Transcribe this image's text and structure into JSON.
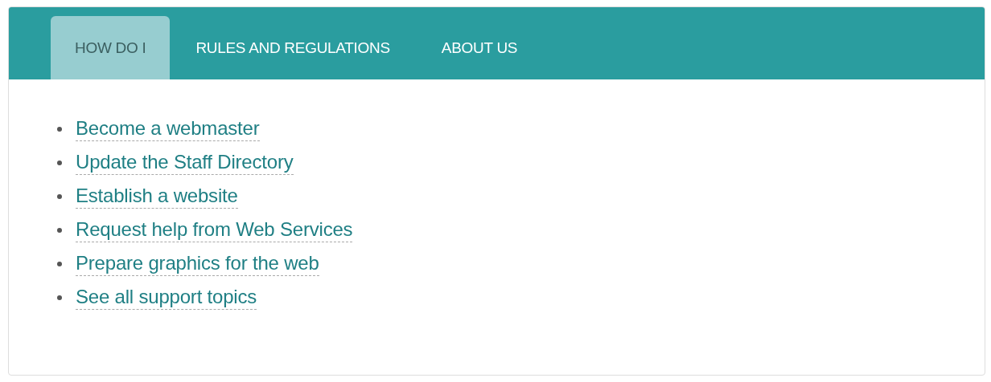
{
  "tabs": [
    {
      "label": "HOW DO I",
      "selected": true
    },
    {
      "label": "RULES AND REGULATIONS",
      "selected": false
    },
    {
      "label": "ABOUT US",
      "selected": false
    }
  ],
  "links": [
    "Become a webmaster",
    "Update the Staff Directory",
    "Establish a website",
    "Request help from Web Services",
    "Prepare graphics for the web",
    "See all support topics"
  ]
}
